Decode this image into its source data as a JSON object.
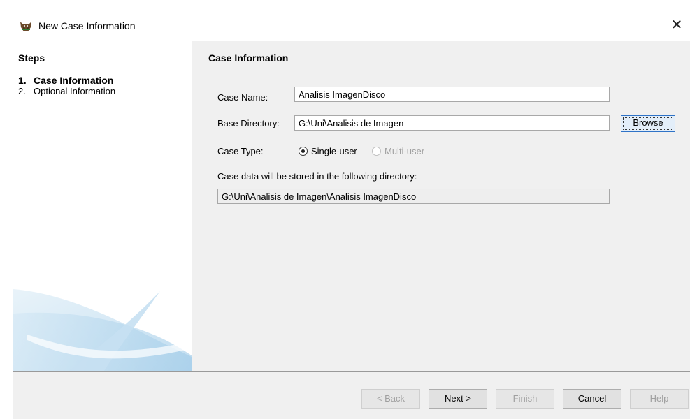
{
  "window": {
    "title": "New Case Information",
    "close_label": "✕",
    "app_icon": "autopsy-dog-icon"
  },
  "steps": {
    "header": "Steps",
    "items": [
      {
        "num": "1.",
        "label": "Case Information",
        "active": true
      },
      {
        "num": "2.",
        "label": "Optional Information",
        "active": false
      }
    ]
  },
  "case_info": {
    "title": "Case Information",
    "case_name_label": "Case Name:",
    "case_name_value": "Analisis ImagenDisco",
    "base_dir_label": "Base Directory:",
    "base_dir_value": "G:\\Uni\\Analisis de Imagen",
    "browse_label": "Browse",
    "case_type_label": "Case Type:",
    "single_user_label": "Single-user",
    "multi_user_label": "Multi-user",
    "stored_label": "Case data will be stored in the following directory:",
    "stored_value": "G:\\Uni\\Analisis de Imagen\\Analisis ImagenDisco"
  },
  "buttons": {
    "back": "< Back",
    "next": "Next >",
    "finish": "Finish",
    "cancel": "Cancel",
    "help": "Help"
  },
  "colors": {
    "accent": "#2f73c7",
    "panel": "#f0f0f0"
  }
}
